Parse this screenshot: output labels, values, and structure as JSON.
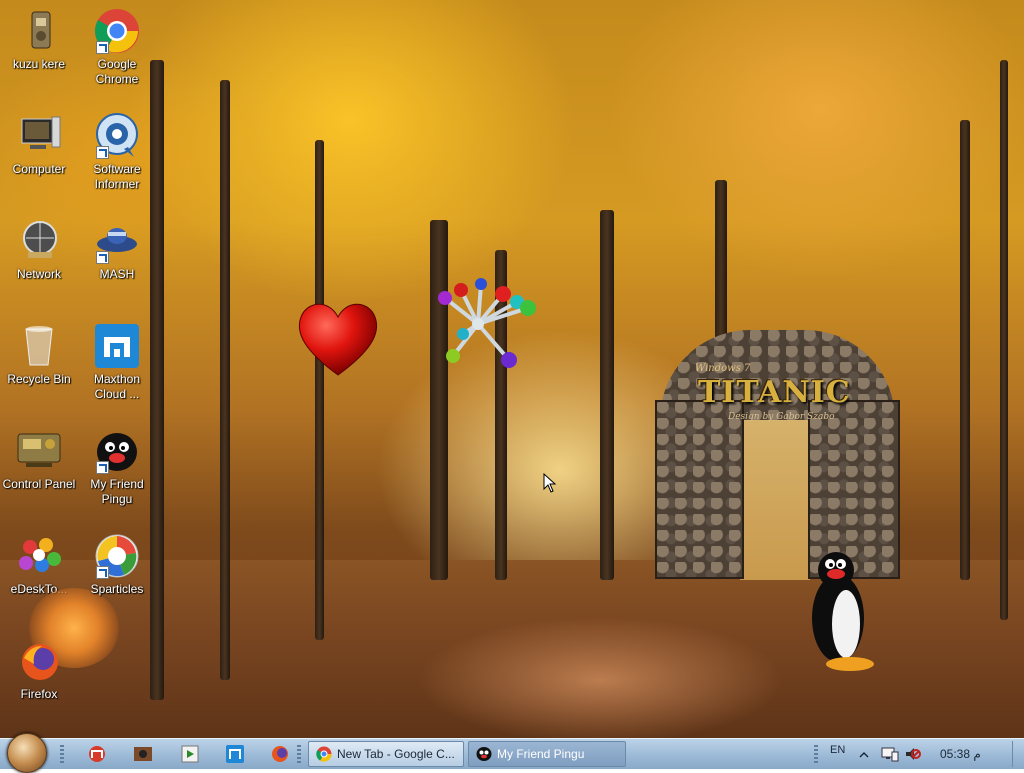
{
  "desktop": {
    "icons": [
      {
        "label": "kuzu kere",
        "icon": "folder-archive-icon"
      },
      {
        "label": "Google Chrome",
        "icon": "chrome-icon"
      },
      {
        "label": "Computer",
        "icon": "computer-icon"
      },
      {
        "label": "Software Informer",
        "icon": "software-informer-icon"
      },
      {
        "label": "Network",
        "icon": "network-icon"
      },
      {
        "label": "MASH",
        "icon": "mash-icon"
      },
      {
        "label": "Recycle Bin",
        "icon": "recycle-bin-icon"
      },
      {
        "label": "Maxthon Cloud ...",
        "icon": "maxthon-icon"
      },
      {
        "label": "Control Panel",
        "icon": "control-panel-icon"
      },
      {
        "label": "My Friend Pingu",
        "icon": "pingu-icon"
      },
      {
        "label": "eDeskTo...",
        "icon": "edesktop-icon"
      },
      {
        "label": "Sparticles",
        "icon": "sparticles-icon"
      },
      {
        "label": "Firefox",
        "icon": "firefox-icon"
      }
    ],
    "wallpaper_brand": {
      "small": "Windows 7",
      "title": "TITANIC",
      "tagline": "Design by Gabor Szabo"
    }
  },
  "taskbar": {
    "quick_launch": [
      "maxthon-icon",
      "pingu-window-icon",
      "media-player-icon",
      "maxthon-cloud-icon",
      "firefox-icon"
    ],
    "tasks": [
      {
        "label": "New Tab - Google C...",
        "icon": "chrome-icon",
        "active": false
      },
      {
        "label": "My Friend Pingu",
        "icon": "pingu-icon",
        "active": true
      }
    ],
    "language": "EN",
    "clock": "05:38 م"
  },
  "colors": {
    "taskbar": "#9fbcd8",
    "task_active": "#7f9ec0",
    "label_text": "#ffffff"
  }
}
